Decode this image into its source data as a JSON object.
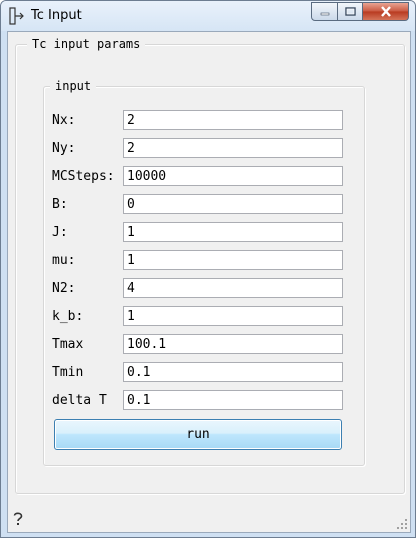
{
  "window": {
    "title": "Tc Input"
  },
  "outer_group": {
    "title": "Tc input params"
  },
  "inner_group": {
    "title": "input"
  },
  "fields": [
    {
      "label": "Nx:",
      "value": "2"
    },
    {
      "label": "Ny:",
      "value": "2"
    },
    {
      "label": "MCSteps:",
      "value": "10000"
    },
    {
      "label": "B:",
      "value": "0"
    },
    {
      "label": "J:",
      "value": "1"
    },
    {
      "label": "mu:",
      "value": "1"
    },
    {
      "label": "N2:",
      "value": "4"
    },
    {
      "label": "k_b:",
      "value": "1"
    },
    {
      "label": "Tmax",
      "value": "100.1"
    },
    {
      "label": "Tmin",
      "value": "0.1"
    },
    {
      "label": "delta T",
      "value": "0.1"
    }
  ],
  "actions": {
    "run_label": "run"
  },
  "icons": {
    "app": "app-window-icon",
    "minimize": "minimize-icon",
    "maximize": "maximize-icon",
    "close": "close-icon",
    "help": "help-question-icon",
    "resize": "resize-grip-icon"
  },
  "colors": {
    "button_border": "#3c7fb1",
    "close_button": "#c9573f"
  }
}
